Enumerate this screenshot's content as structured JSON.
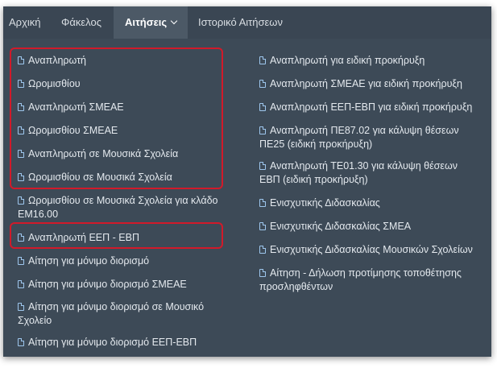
{
  "navbar": {
    "items": [
      {
        "label": "Αρχική"
      },
      {
        "label": "Φάκελος"
      },
      {
        "label": "Αιτήσεις"
      },
      {
        "label": "Ιστορικό Αιτήσεων"
      }
    ]
  },
  "menu": {
    "left": [
      {
        "label": "Αναπληρωτή"
      },
      {
        "label": "Ωρομισθίου"
      },
      {
        "label": "Αναπληρωτή ΣΜΕΑΕ"
      },
      {
        "label": "Ωρομισθίου ΣΜΕΑΕ"
      },
      {
        "label": "Αναπληρωτή σε Μουσικά Σχολεία"
      },
      {
        "label": "Ωρομισθίου σε Μουσικά Σχολεία"
      },
      {
        "label": "Ωρομισθίου σε Μουσικά Σχολεία για κλάδο",
        "label2": "ΕΜ16.00"
      },
      {
        "label": "Αναπληρωτή ΕΕΠ - ΕΒΠ"
      },
      {
        "label": "Αίτηση για μόνιμο διορισμό"
      },
      {
        "label": "Αίτηση για μόνιμο διορισμό ΣΜΕΑΕ"
      },
      {
        "label": "Αίτηση για μόνιμο διορισμό σε Μουσικό",
        "label2": "Σχολείο"
      },
      {
        "label": "Αίτηση για μόνιμο διορισμό ΕΕΠ-ΕΒΠ"
      }
    ],
    "right": [
      {
        "label": "Αναπληρωτή για ειδική προκήρυξη"
      },
      {
        "label": "Αναπληρωτή ΣΜΕΑΕ για ειδική προκήρυξη"
      },
      {
        "label": "Αναπληρωτή ΕΕΠ-ΕΒΠ για ειδική προκήρυξη"
      },
      {
        "label": "Αναπληρωτή ΠΕ87.02 για κάλυψη θέσεων",
        "label2": "ΠΕ25 (ειδική προκήρυξη)"
      },
      {
        "label": "Αναπληρωτή ΤΕ01.30 για κάλυψη θέσεων",
        "label2": "ΕΒΠ (ειδική προκήρυξη)"
      },
      {
        "label": "Ενισχυτικής Διδασκαλίας"
      },
      {
        "label": "Ενισχυτικής Διδασκαλίας ΣΜΕΑ"
      },
      {
        "label": "Ενισχυτικής Διδασκαλίας Μουσικών Σχολείων"
      },
      {
        "label": "Αίτηση - Δήλωση προτίμησης τοποθέτησης",
        "label2": "προσληφθέντων"
      }
    ]
  },
  "colors": {
    "navbar_bg": "#3a4653",
    "menu_bg": "#3d4a57",
    "active_tab_bg": "#4c5966",
    "highlight_border": "#d11a2a",
    "icon_color": "#9ec7ee"
  },
  "icons": {
    "menu_item": "document-icon",
    "dropdown": "chevron-down-icon"
  }
}
